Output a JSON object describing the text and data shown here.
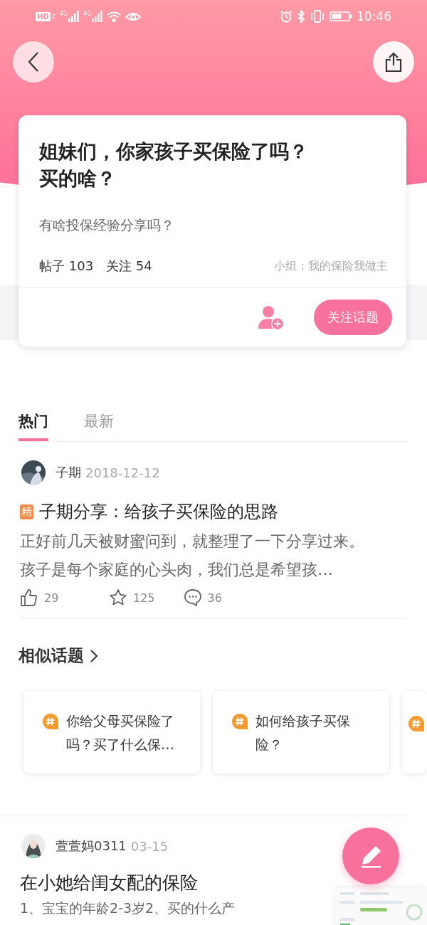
{
  "status_bar": {
    "hd_badge": "HD",
    "sim_index": "2",
    "networks": [
      "4G",
      "4G"
    ],
    "time": "10:46"
  },
  "topic": {
    "title": "姐妹们，你家孩子买保险了吗？买的啥？",
    "description": "有啥投保经验分享吗？",
    "posts_label": "帖子 103",
    "followers_label": "关注 54",
    "group_label": "小组：我的保险我做主",
    "follow_button": "关注话题"
  },
  "tabs": [
    {
      "label": "热门",
      "selected": true
    },
    {
      "label": "最新",
      "selected": false
    }
  ],
  "posts": [
    {
      "author": "子期",
      "date": "2018-12-12",
      "featured_badge": "精",
      "title": "子期分享：给孩子买保险的思路",
      "excerpt": "正好前几天被财蜜问到，就整理了一下分享过来。孩子是每个家庭的心头肉，我们总是希望孩…",
      "likes": "29",
      "favorites": "125",
      "comments": "36"
    }
  ],
  "similar_topics": {
    "heading": "相似话题",
    "items": [
      {
        "title": "你给父母买保险了吗？买了什么保…"
      },
      {
        "title": "如何给孩子买保险？"
      }
    ]
  },
  "second_post": {
    "author": "萱萱妈0311",
    "date": "03-15",
    "title": "在小她给闺女配的保险",
    "excerpt": "1、宝宝的年龄2-3岁2、买的什么产"
  }
}
